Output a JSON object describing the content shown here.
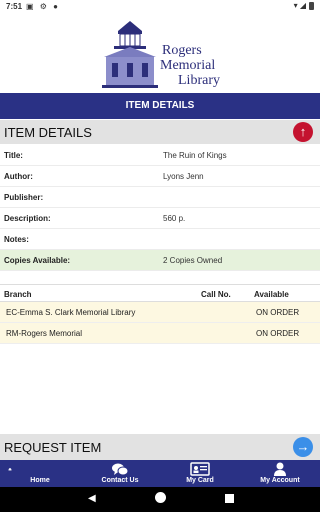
{
  "status_bar": {
    "time": "7:51",
    "left_icons": "▣ ⚙ ●",
    "right_icons": "▾ ◢"
  },
  "logo": {
    "line1": "Rogers",
    "line2": "Memorial",
    "line3": "Library"
  },
  "header": {
    "title": "ITEM DETAILS"
  },
  "item_details": {
    "heading": "ITEM DETAILS",
    "rows": [
      {
        "label": "Title:",
        "value": "The Ruin of Kings"
      },
      {
        "label": "Author:",
        "value": "Lyons Jenn"
      },
      {
        "label": "Publisher:",
        "value": ""
      },
      {
        "label": "Description:",
        "value": "560 p."
      },
      {
        "label": "Notes:",
        "value": ""
      },
      {
        "label": "Copies Available:",
        "value": "2 Copies Owned"
      }
    ]
  },
  "branches": {
    "columns": {
      "branch": "Branch",
      "call_no": "Call No.",
      "available": "Available"
    },
    "rows": [
      {
        "branch": "EC-Emma S. Clark Memorial Library",
        "call_no": "",
        "available": "ON ORDER"
      },
      {
        "branch": "RM-Rogers Memorial",
        "call_no": "",
        "available": "ON ORDER"
      }
    ]
  },
  "request": {
    "heading": "REQUEST ITEM"
  },
  "nav": {
    "home": "Home",
    "contact": "Contact Us",
    "card": "My Card",
    "account": "My Account"
  },
  "colors": {
    "brand_blue": "#2a3185",
    "scroll_up_red": "#c4122f",
    "request_arrow_blue": "#3b8fe8",
    "highlight_green": "#e6f2dc",
    "row_yellow": "#fdf8e1"
  }
}
